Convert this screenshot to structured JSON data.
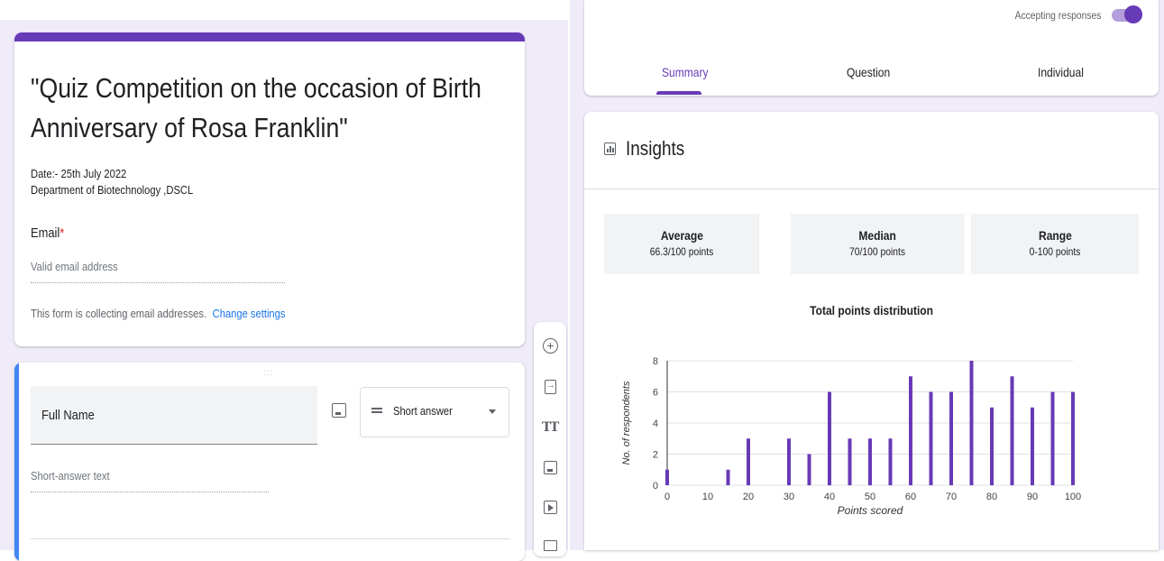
{
  "form": {
    "title": "\"Quiz Competition on the occasion of Birth Anniversary of Rosa Franklin\"",
    "description_line1": "Date:- 25th July 2022",
    "description_line2": "Department of Biotechnology ,DSCL",
    "email_label": "Email",
    "required_mark": "*",
    "email_placeholder": "Valid email address",
    "collecting_note": "This form is collecting email addresses.",
    "change_settings_link": "Change settings"
  },
  "question": {
    "drag_handle": ":::",
    "title": "Full Name",
    "type": "Short answer",
    "answer_placeholder": "Short-answer text"
  },
  "toolbar": {
    "icons": [
      "add-question-icon",
      "import-questions-icon",
      "add-title-icon",
      "add-image-icon",
      "add-video-icon",
      "add-section-icon"
    ]
  },
  "responses": {
    "accepting_label": "Accepting responses",
    "accepting": true,
    "tabs": [
      "Summary",
      "Question",
      "Individual"
    ],
    "active_tab": "Summary"
  },
  "insights": {
    "title": "Insights",
    "stats": [
      {
        "label": "Average",
        "value": "66.3/100 points"
      },
      {
        "label": "Median",
        "value": "70/100 points"
      },
      {
        "label": "Range",
        "value": "0-100 points"
      }
    ]
  },
  "colors": {
    "accent": "#673ab7",
    "question_accent": "#4285f4",
    "link": "#1a73e8",
    "bar": "#673ab7"
  },
  "chart_data": {
    "type": "bar",
    "title": "Total points distribution",
    "xlabel": "Points scored",
    "ylabel": "No. of respondents",
    "xlim": [
      0,
      100
    ],
    "ylim": [
      0,
      8
    ],
    "xticks": [
      0,
      10,
      20,
      30,
      40,
      50,
      60,
      70,
      80,
      90,
      100
    ],
    "yticks": [
      0,
      2,
      4,
      6,
      8
    ],
    "x": [
      0,
      15,
      20,
      30,
      35,
      40,
      45,
      50,
      55,
      60,
      65,
      70,
      75,
      80,
      85,
      90,
      95,
      100
    ],
    "values": [
      1,
      1,
      3,
      3,
      2,
      6,
      3,
      3,
      3,
      7,
      6,
      6,
      8,
      5,
      7,
      5,
      6,
      6
    ]
  }
}
